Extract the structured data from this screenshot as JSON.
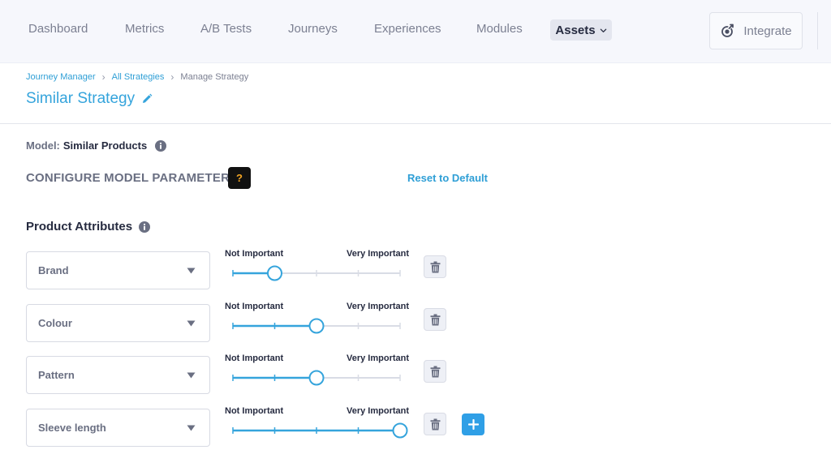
{
  "nav": {
    "items": [
      "Dashboard",
      "Metrics",
      "A/B Tests",
      "Journeys",
      "Experiences",
      "Modules"
    ],
    "active": "Assets",
    "integrate": "Integrate"
  },
  "breadcrumb": {
    "items": [
      "Journey Manager",
      "All Strategies"
    ],
    "current": "Manage Strategy"
  },
  "page": {
    "title": "Similar Strategy"
  },
  "model": {
    "label": "Model:",
    "value": "Similar Products"
  },
  "config": {
    "title": "CONFIGURE MODEL PARAMETERS",
    "help": "?",
    "reset": "Reset to Default"
  },
  "attributes": {
    "title": "Product Attributes",
    "scale_min_label": "Not Important",
    "scale_max_label": "Very Important",
    "scale_steps": 4,
    "rows": [
      {
        "name": "Brand",
        "importance": 1
      },
      {
        "name": "Colour",
        "importance": 2
      },
      {
        "name": "Pattern",
        "importance": 2
      },
      {
        "name": "Sleeve length",
        "importance": 4
      }
    ]
  },
  "colors": {
    "accent": "#35a4dc",
    "track": "#d9dce5",
    "help_bg": "#111111",
    "help_fg": "#f5a623",
    "add_bg": "#2f9fe6"
  }
}
